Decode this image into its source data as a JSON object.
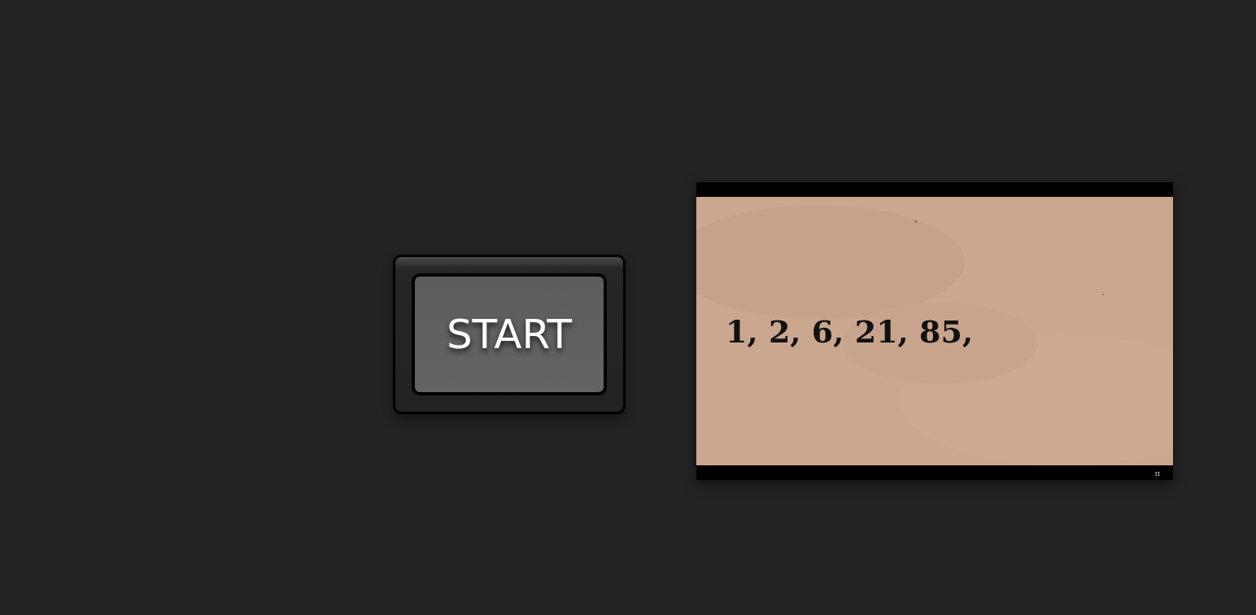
{
  "start_button": {
    "label": "START"
  },
  "card": {
    "sequence": "1, 2, 6, 21, 85,",
    "corner_mark": "π"
  }
}
